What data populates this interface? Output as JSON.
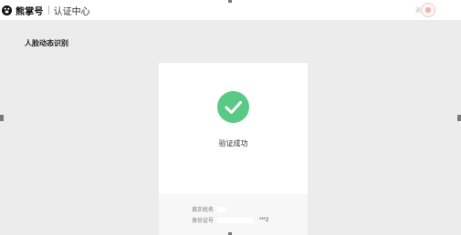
{
  "header": {
    "brand": "熊掌号",
    "title": "认证中心",
    "corner_label": "返回"
  },
  "page": {
    "section_title": "人脸动态识别"
  },
  "result": {
    "status_text": "验证成功",
    "icon": "check-icon",
    "accent_color": "#5bc986"
  },
  "info": {
    "name_label": "真实姓名",
    "id_label": "身份证号",
    "id_suffix": "***2"
  }
}
